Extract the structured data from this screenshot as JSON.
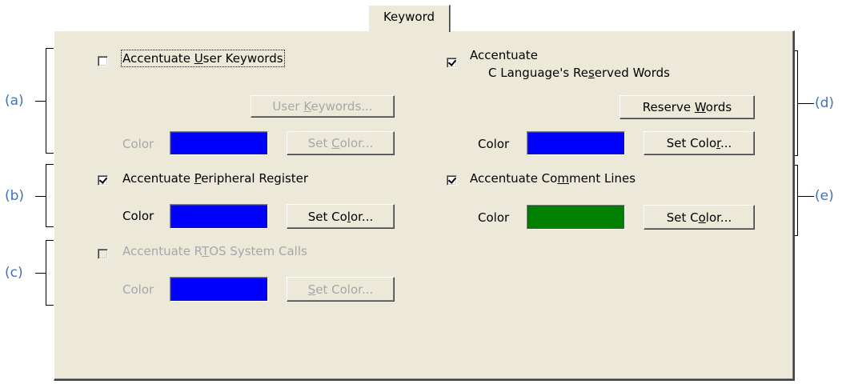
{
  "tab": {
    "label": "Keyword"
  },
  "user_keywords": {
    "label_pre": "Accentuate ",
    "label_key": "U",
    "label_post": "ser Keywords",
    "checked": false,
    "button_pre": "User ",
    "button_key": "K",
    "button_post": "eywords...",
    "color_label": "Color",
    "color": "#0000ff",
    "set_color_pre": "Set ",
    "set_color_key": "C",
    "set_color_post": "olor..."
  },
  "peripheral": {
    "label_pre": "Accentuate ",
    "label_key": "P",
    "label_post": "eripheral Register",
    "checked": true,
    "color_label": "Color",
    "color": "#0000ff",
    "set_color_pre": "Set Co",
    "set_color_key": "l",
    "set_color_post": "or..."
  },
  "rtos": {
    "label_pre": "Accentuate R",
    "label_key": "T",
    "label_post": "OS System Calls",
    "checked": false,
    "color_label": "Color",
    "color": "#0000ff",
    "set_color_pre": "",
    "set_color_key": "S",
    "set_color_post": "et Color..."
  },
  "reserved": {
    "label_line1": "Accentuate",
    "label_line2_pre": "C Language's Re",
    "label_line2_key": "s",
    "label_line2_post": "erved Words",
    "checked": true,
    "button_pre": "Reserve ",
    "button_key": "W",
    "button_post": "ords",
    "color_label": "Color",
    "color": "#0000ff",
    "set_color_pre": "Set Colo",
    "set_color_key": "r",
    "set_color_post": "..."
  },
  "comment": {
    "label_pre": "Accentuate Co",
    "label_key": "m",
    "label_post": "ment Lines",
    "checked": true,
    "color_label": "Color",
    "color": "#008000",
    "set_color_pre": "Set C",
    "set_color_key": "o",
    "set_color_post": "lor..."
  },
  "callouts": {
    "a": "(a)",
    "b": "(b)",
    "c": "(c)",
    "d": "(d)",
    "e": "(e)"
  }
}
